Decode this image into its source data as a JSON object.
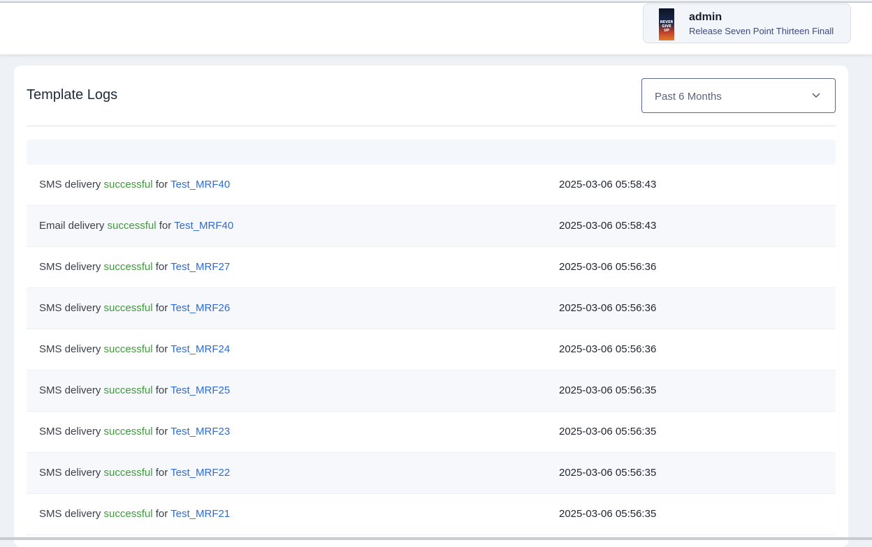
{
  "header": {
    "user": {
      "name": "admin",
      "subtitle": "Release Seven Point Thirteen Finall",
      "avatar_text": "NEVER GIVE UP",
      "avatar_icon": "profile-image"
    }
  },
  "page": {
    "title": "Template Logs",
    "period_select": {
      "value": "Past 6 Months",
      "icon": "chevron-down-icon"
    }
  },
  "colors": {
    "success": "#3f9a3c",
    "link": "#2f6bd6",
    "title": "#1e2a3b"
  },
  "logs": [
    {
      "channel": "SMS delivery",
      "status": "successful",
      "connector": "for",
      "template": "Test_MRF40",
      "time": "2025-03-06 05:58:43"
    },
    {
      "channel": "Email delivery",
      "status": "successful",
      "connector": "for",
      "template": "Test_MRF40",
      "time": "2025-03-06 05:58:43"
    },
    {
      "channel": "SMS delivery",
      "status": "successful",
      "connector": "for",
      "template": "Test_MRF27",
      "time": "2025-03-06 05:56:36"
    },
    {
      "channel": "SMS delivery",
      "status": "successful",
      "connector": "for",
      "template": "Test_MRF26",
      "time": "2025-03-06 05:56:36"
    },
    {
      "channel": "SMS delivery",
      "status": "successful",
      "connector": "for",
      "template": "Test_MRF24",
      "time": "2025-03-06 05:56:36"
    },
    {
      "channel": "SMS delivery",
      "status": "successful",
      "connector": "for",
      "template": "Test_MRF25",
      "time": "2025-03-06 05:56:35"
    },
    {
      "channel": "SMS delivery",
      "status": "successful",
      "connector": "for",
      "template": "Test_MRF23",
      "time": "2025-03-06 05:56:35"
    },
    {
      "channel": "SMS delivery",
      "status": "successful",
      "connector": "for",
      "template": "Test_MRF22",
      "time": "2025-03-06 05:56:35"
    },
    {
      "channel": "SMS delivery",
      "status": "successful",
      "connector": "for",
      "template": "Test_MRF21",
      "time": "2025-03-06 05:56:35"
    }
  ]
}
